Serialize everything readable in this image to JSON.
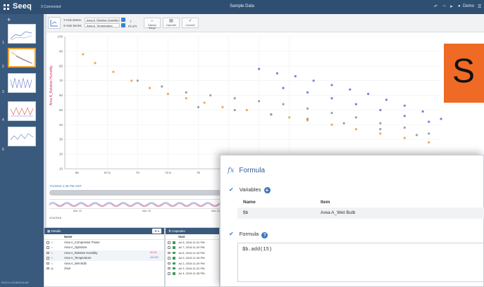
{
  "app": {
    "logo": "Seeq",
    "connection": "3 Connected",
    "title": "Sample Data",
    "user": "Demo"
  },
  "worksheets": {
    "add_label": "+",
    "numbers": [
      "1",
      "2",
      "3",
      "4",
      "5"
    ],
    "version": "R18.0.0-v201803141450"
  },
  "toolbar": {
    "y_label": "Y-Axis Series:",
    "y_value": "Area A_Relative Humidity",
    "x_label": "X-Axis Series:",
    "x_value": "Area A_Temperature",
    "fit_label": "Fit X/Y",
    "tools": [
      "Display Range",
      "Capsules",
      "Connect"
    ]
  },
  "chart_data": {
    "type": "scatter",
    "title": "",
    "xlabel": "",
    "ylabel": "Area A_Relative Humidity",
    "xlim": [
      64,
      95
    ],
    "ylim": [
      10,
      100
    ],
    "x_ticks": [
      65,
      67.5,
      70,
      72.5,
      75,
      77.5,
      80,
      82.5
    ],
    "y_ticks": [
      10,
      20,
      30,
      40,
      50,
      60,
      70,
      80,
      90,
      100
    ],
    "grid": true,
    "series": [
      {
        "color": "#e8a030",
        "x": [
          65.5,
          66.5,
          68,
          69.5,
          71,
          72.5,
          74,
          75.5,
          77,
          79,
          81,
          82.5,
          84,
          86,
          88,
          90,
          92,
          94
        ],
        "y": [
          88,
          82,
          76,
          70,
          65,
          61,
          58,
          55,
          52,
          50,
          47,
          45,
          43,
          40,
          37,
          34,
          31,
          28
        ]
      },
      {
        "color": "#5b6cd8",
        "x": [
          80,
          81.5,
          83,
          84.5,
          86,
          87.5,
          89,
          90.5,
          92,
          93.5,
          95,
          82,
          84,
          86,
          88,
          90,
          92,
          94
        ],
        "y": [
          78,
          75,
          73,
          70,
          67,
          64,
          61,
          57,
          53,
          49,
          44,
          65,
          62,
          58,
          54,
          50,
          46,
          42
        ]
      },
      {
        "color": "#8a8f96",
        "x": [
          70,
          72,
          74,
          76,
          78,
          80,
          82,
          84,
          86,
          88,
          90,
          92,
          94,
          75,
          78,
          81,
          84,
          87,
          90,
          93
        ],
        "y": [
          70,
          66,
          62,
          60,
          58,
          56,
          54,
          51,
          48,
          45,
          41,
          38,
          34,
          52,
          50,
          47,
          44,
          41,
          37,
          33
        ]
      }
    ]
  },
  "timeline": {
    "datetime": "7/1/2016 1:36 PM CDT",
    "duration": "6 days",
    "ticks": [
      "Mar 22",
      "Mar 23",
      "Mar 24",
      "Mar 25",
      "Mar 26"
    ],
    "start_date": "3/14/2018"
  },
  "details": {
    "header": "Details",
    "col_name": "Name",
    "rows": [
      {
        "name": "Area A_Compressor Power",
        "value": ""
      },
      {
        "name": "Area A_Optimizer",
        "value": ""
      },
      {
        "name": "Area A_Relative Humidity",
        "value": "52.60"
      },
      {
        "name": "Area A_Temperature",
        "value": "101.80"
      },
      {
        "name": "Area A_Wet Bulb",
        "value": ""
      },
      {
        "name": "chair",
        "value": ""
      }
    ]
  },
  "capsules": {
    "header": "Capsules",
    "col_start": "Start",
    "rows": [
      "Jul 6, 2016 11:31 PM",
      "Jul 7, 2016 11:29 PM",
      "Jul 8, 2016 11:33 PM",
      "Jul 9, 2016 11:33 PM",
      "Jul 2, 2016 11:29 PM",
      "Jul 3, 2016 11:31 PM",
      "Jul 4, 2016 11:35 PM"
    ]
  },
  "formula": {
    "title": "Formula",
    "variables_label": "Variables",
    "col_name": "Name",
    "col_item": "Item",
    "var_name": "$b",
    "var_item": "Area A_Wet Bulb",
    "formula_label": "Formula",
    "code": "$b.add(15)"
  },
  "banner": {
    "text": "S"
  },
  "colors": {
    "header": "#2f4f72",
    "sidebar": "#3a5a7d",
    "accent": "#3c78bd",
    "banner": "#ef6a25"
  }
}
